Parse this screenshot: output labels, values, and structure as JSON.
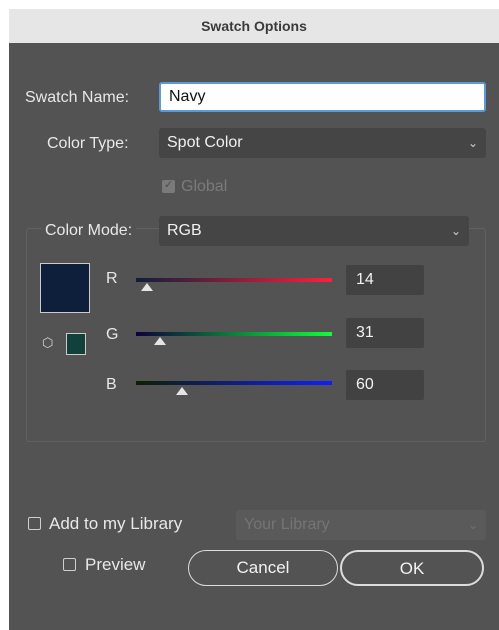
{
  "title": "Swatch Options",
  "swatch_name": {
    "label": "Swatch Name:",
    "value": "Navy"
  },
  "color_type": {
    "label": "Color Type:",
    "value": "Spot Color"
  },
  "global": {
    "label": "Global",
    "checked": true,
    "disabled": true
  },
  "color_mode": {
    "label": "Color Mode:",
    "value": "RGB"
  },
  "swatch_color": "#0e1f3c",
  "gamut_color": "#12403a",
  "channels": [
    {
      "label": "R",
      "value": "14",
      "fraction": 0.055,
      "gradient_start": "#0e1f3c",
      "gradient_end": "#ff1f3c"
    },
    {
      "label": "G",
      "value": "31",
      "fraction": 0.12,
      "gradient_start": "#0e003c",
      "gradient_end": "#0eff3c"
    },
    {
      "label": "B",
      "value": "60",
      "fraction": 0.235,
      "gradient_start": "#0e1f00",
      "gradient_end": "#0e1fff"
    }
  ],
  "library": {
    "label": "Add to my Library",
    "checked": false,
    "select_placeholder": "Your Library"
  },
  "footer": {
    "preview_label": "Preview",
    "preview_checked": false,
    "cancel_label": "Cancel",
    "ok_label": "OK"
  }
}
